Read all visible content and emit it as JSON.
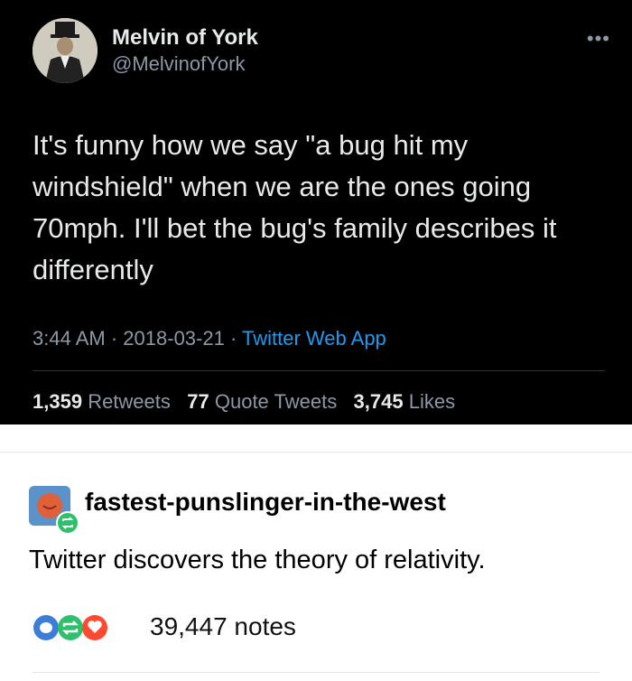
{
  "tweet": {
    "display_name": "Melvin of York",
    "handle": "@MelvinofYork",
    "more_icon": "more-horizontal-icon",
    "text": "It's funny how we say \"a bug hit my windshield\" when we are the ones going 70mph. I'll bet the bug's family describes it differently",
    "time": "3:44 AM",
    "date": "2018-03-21",
    "app": "Twitter Web App",
    "stats": {
      "retweets_count": "1,359",
      "retweets_label": "Retweets",
      "quotes_count": "77",
      "quotes_label": "Quote Tweets",
      "likes_count": "3,745",
      "likes_label": "Likes"
    }
  },
  "tumblr": {
    "username": "fastest-punslinger-in-the-west",
    "post_text": "Twitter discovers the theory of relativity.",
    "notes": "39,447 notes"
  },
  "colors": {
    "tweet_bg": "#000000",
    "link_blue": "#1d9bf0",
    "reply_blue": "#3b7dd8",
    "reblog_green": "#2ec06a",
    "like_red": "#ff4930"
  }
}
